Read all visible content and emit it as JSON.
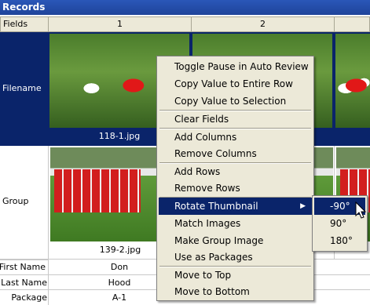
{
  "window": {
    "title": "Records"
  },
  "grid": {
    "corner_label": "Fields",
    "columns": [
      "1",
      "2"
    ],
    "rows": [
      {
        "label": "Filename",
        "values": [
          "118-1.jpg",
          ""
        ]
      },
      {
        "label": "Group",
        "values": [
          "139-2.jpg",
          ""
        ]
      },
      {
        "label": "First Name",
        "values": [
          "Don",
          ""
        ]
      },
      {
        "label": "Last Name",
        "values": [
          "Hood",
          ""
        ]
      },
      {
        "label": "Package",
        "values": [
          "A-1",
          ""
        ]
      }
    ]
  },
  "context_menu": {
    "groups": [
      [
        "Toggle Pause in Auto Review",
        "Copy Value to Entire Row",
        "Copy Value to Selection"
      ],
      [
        "Clear Fields"
      ],
      [
        "Add Columns",
        "Remove Columns"
      ],
      [
        "Add Rows",
        "Remove Rows"
      ],
      [
        "Rotate Thumbnail",
        "Match Images",
        "Make Group Image",
        "Use as Packages"
      ],
      [
        "Move to Top",
        "Move to Bottom"
      ]
    ],
    "active_item": "Rotate Thumbnail",
    "submenu_arrow": "▶"
  },
  "submenu": {
    "items": [
      "-90°",
      "90°",
      "180°"
    ],
    "active_item": "-90°"
  },
  "colors": {
    "selection": "#0a246a",
    "menu_bg": "#ece9d8",
    "title_bg": "#1f449a"
  },
  "icons": {
    "cursor": "mouse-pointer-icon",
    "arrow": "submenu-arrow-icon"
  }
}
